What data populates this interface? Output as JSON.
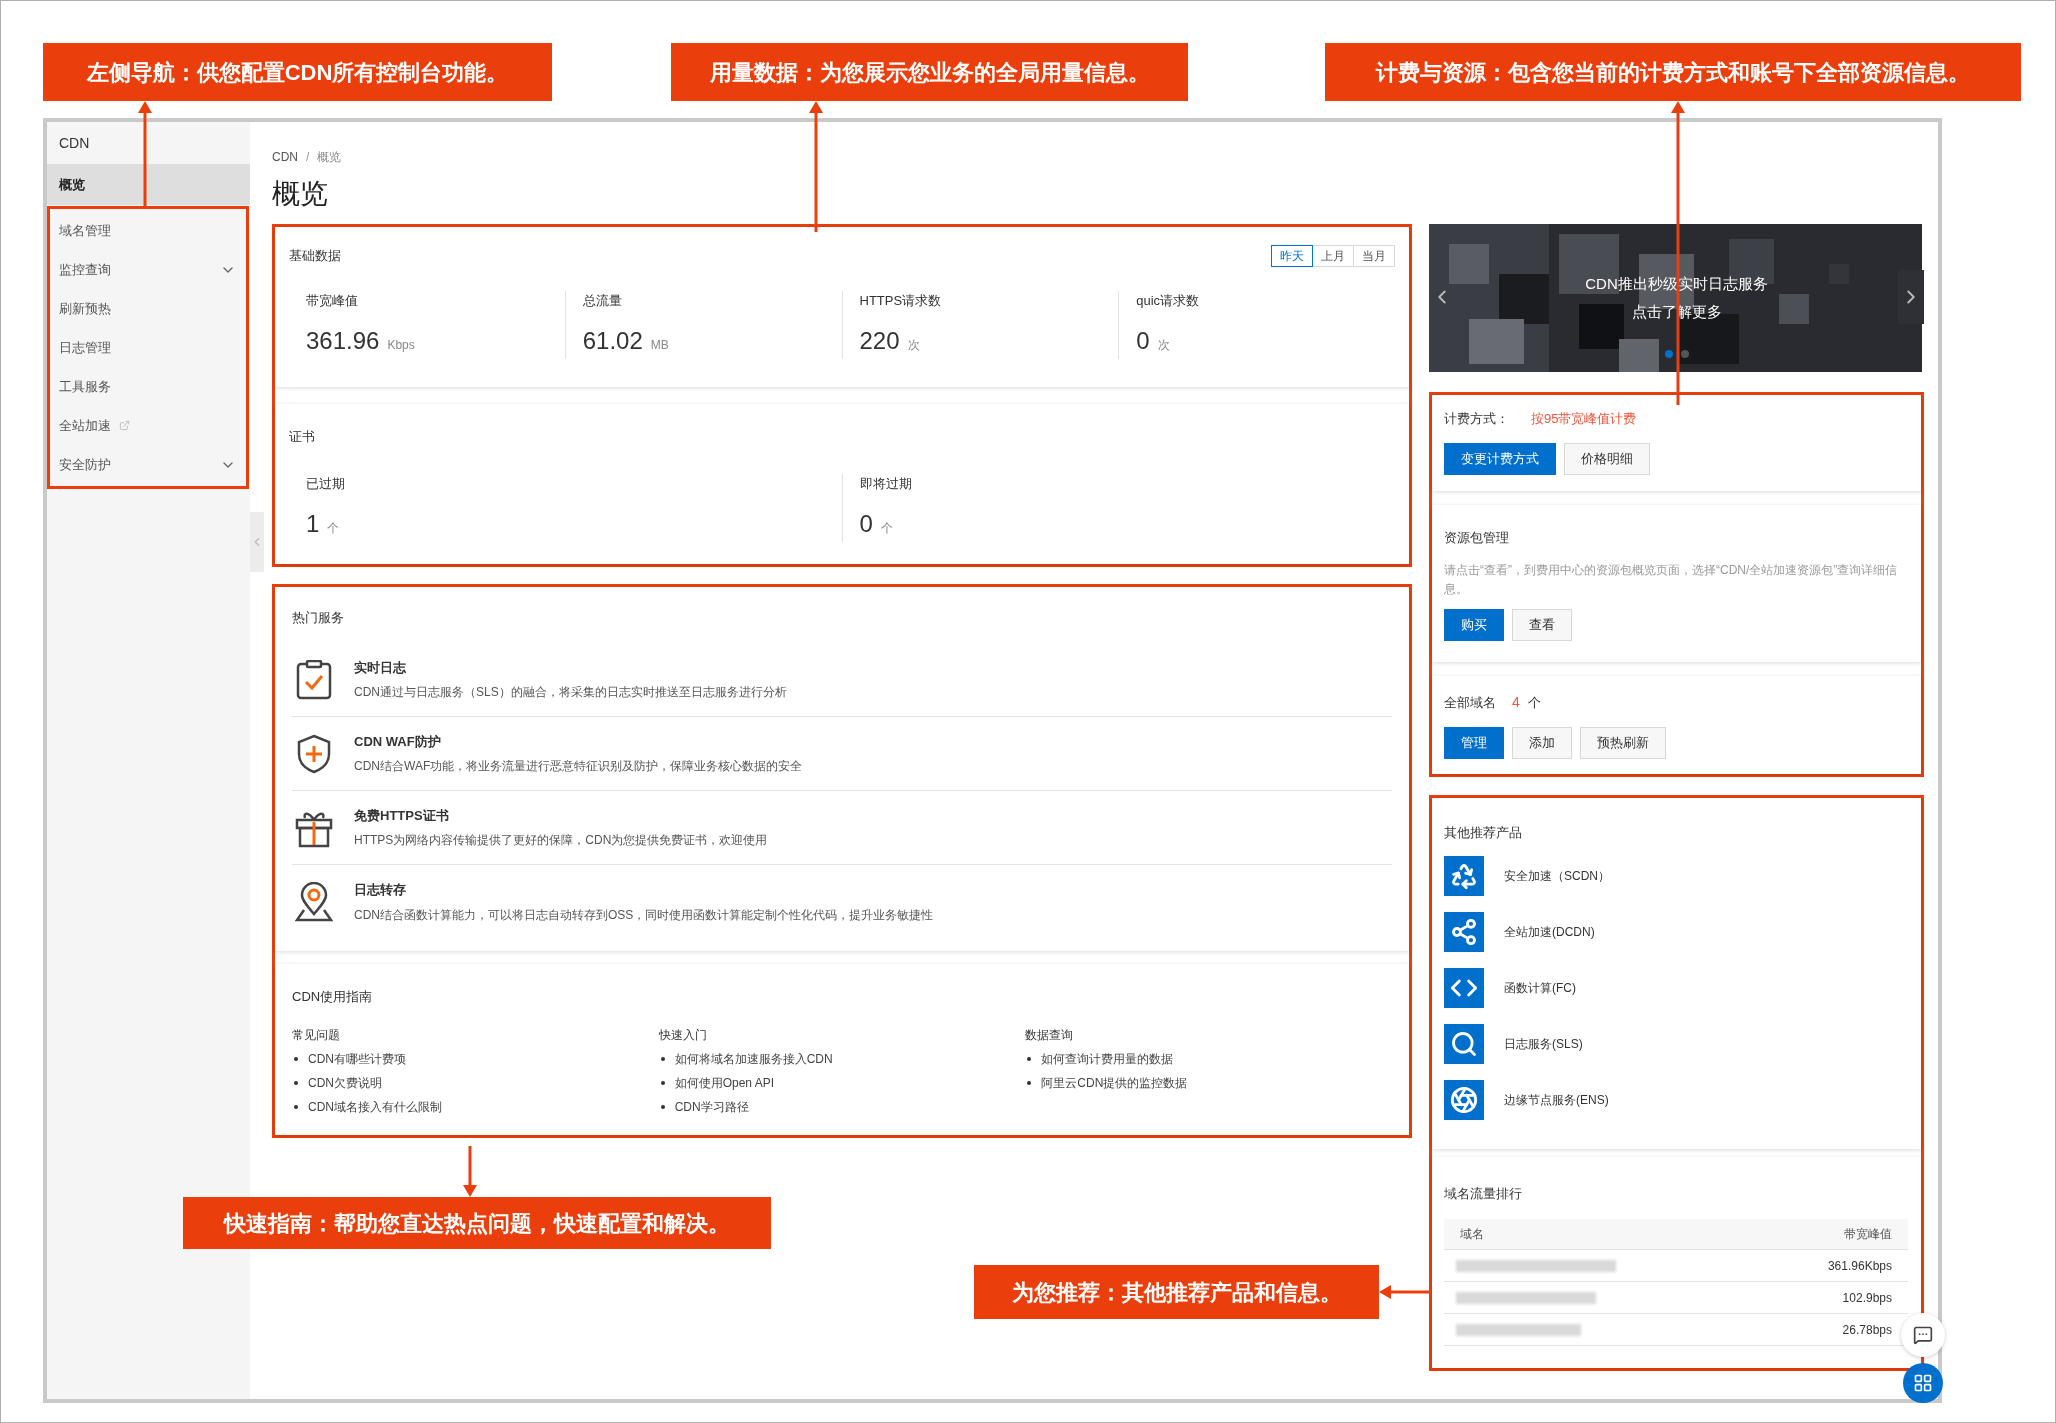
{
  "callouts": [
    {
      "text": "左侧导航：供您配置CDN所有控制台功能。"
    },
    {
      "text": "用量数据：为您展示您业务的全局用量信息。"
    },
    {
      "text": "计费与资源：包含您当前的计费方式和账号下全部资源信息。"
    },
    {
      "text": "快速指南：帮助您直达热点问题，快速配置和解决。"
    },
    {
      "text": "为您推荐：其他推荐产品和信息。"
    }
  ],
  "sidebar": {
    "title": "CDN",
    "items": [
      {
        "label": "概览",
        "selected": true,
        "kind": "plain"
      },
      {
        "label": "域名管理",
        "selected": false,
        "kind": "plain"
      },
      {
        "label": "监控查询",
        "selected": false,
        "kind": "submenu"
      },
      {
        "label": "刷新预热",
        "selected": false,
        "kind": "plain"
      },
      {
        "label": "日志管理",
        "selected": false,
        "kind": "plain"
      },
      {
        "label": "工具服务",
        "selected": false,
        "kind": "plain"
      },
      {
        "label": "全站加速",
        "selected": false,
        "kind": "external"
      },
      {
        "label": "安全防护",
        "selected": false,
        "kind": "submenu"
      }
    ]
  },
  "breadcrumb": {
    "items": [
      "CDN",
      "概览"
    ],
    "separator": "/"
  },
  "page_title": "概览",
  "basic_data": {
    "title": "基础数据",
    "periods": [
      {
        "label": "昨天",
        "selected": true
      },
      {
        "label": "上月",
        "selected": false
      },
      {
        "label": "当月",
        "selected": false
      }
    ],
    "metrics": [
      {
        "label": "带宽峰值",
        "value": "361.96",
        "unit": "Kbps"
      },
      {
        "label": "总流量",
        "value": "61.02",
        "unit": "MB"
      },
      {
        "label": "HTTPS请求数",
        "value": "220",
        "unit": "次"
      },
      {
        "label": "quic请求数",
        "value": "0",
        "unit": "次"
      }
    ]
  },
  "certificates": {
    "title": "证书",
    "metrics": [
      {
        "label": "已过期",
        "value": "1",
        "unit": "个"
      },
      {
        "label": "即将过期",
        "value": "0",
        "unit": "个"
      }
    ]
  },
  "hot_services": {
    "title": "热门服务",
    "items": [
      {
        "title": "实时日志",
        "description": "CDN通过与日志服务（SLS）的融合，将采集的日志实时推送至日志服务进行分析"
      },
      {
        "title": "CDN WAF防护",
        "description": "CDN结合WAF功能，将业务流量进行恶意特征识别及防护，保障业务核心数据的安全"
      },
      {
        "title": "免费HTTPS证书",
        "description": "HTTPS为网络内容传输提供了更好的保障，CDN为您提供免费证书，欢迎使用"
      },
      {
        "title": "日志转存",
        "description": "CDN结合函数计算能力，可以将日志自动转存到OSS，同时使用函数计算能定制个性化代码，提升业务敏捷性"
      }
    ]
  },
  "guide": {
    "title": "CDN使用指南",
    "columns": [
      {
        "heading": "常见问题",
        "links": [
          "CDN有哪些计费项",
          "CDN欠费说明",
          "CDN域名接入有什么限制"
        ]
      },
      {
        "heading": "快速入门",
        "links": [
          "如何将域名加速服务接入CDN",
          "如何使用Open API",
          "CDN学习路径"
        ]
      },
      {
        "heading": "数据查询",
        "links": [
          "如何查询计费用量的数据",
          "阿里云CDN提供的监控数据"
        ]
      }
    ]
  },
  "banner": {
    "lines": [
      "CDN推出秒级实时日志服务",
      "点击了解更多"
    ],
    "slides": [
      {
        "selected": true
      },
      {
        "selected": false
      }
    ]
  },
  "billing": {
    "label": "计费方式：",
    "value": "按95带宽峰值计费",
    "buttons": [
      {
        "label": "变更计费方式",
        "kind": "primary"
      },
      {
        "label": "价格明细",
        "kind": "default"
      }
    ]
  },
  "packages": {
    "title": "资源包管理",
    "description": "请点击“查看”，到费用中心的资源包概览页面，选择“CDN/全站加速资源包”查询详细信息。",
    "buttons": [
      {
        "label": "购买",
        "kind": "primary"
      },
      {
        "label": "查看",
        "kind": "default"
      }
    ]
  },
  "domains": {
    "label": "全部域名",
    "count": "4",
    "unit": "个",
    "buttons": [
      {
        "label": "管理",
        "kind": "primary"
      },
      {
        "label": "添加",
        "kind": "default"
      },
      {
        "label": "预热刷新",
        "kind": "default"
      }
    ]
  },
  "recommended": {
    "title": "其他推荐产品",
    "products": [
      {
        "name": "安全加速（SCDN）"
      },
      {
        "name": "全站加速(DCDN)"
      },
      {
        "name": "函数计算(FC)"
      },
      {
        "name": "日志服务(SLS)"
      },
      {
        "name": "边缘节点服务(ENS)"
      }
    ]
  },
  "ranking": {
    "title": "域名流量排行",
    "columns": [
      "域名",
      "带宽峰值"
    ],
    "rows": [
      {
        "bandwidth": "361.96Kbps"
      },
      {
        "bandwidth": "102.9bps"
      },
      {
        "bandwidth": "26.78bps"
      }
    ]
  }
}
